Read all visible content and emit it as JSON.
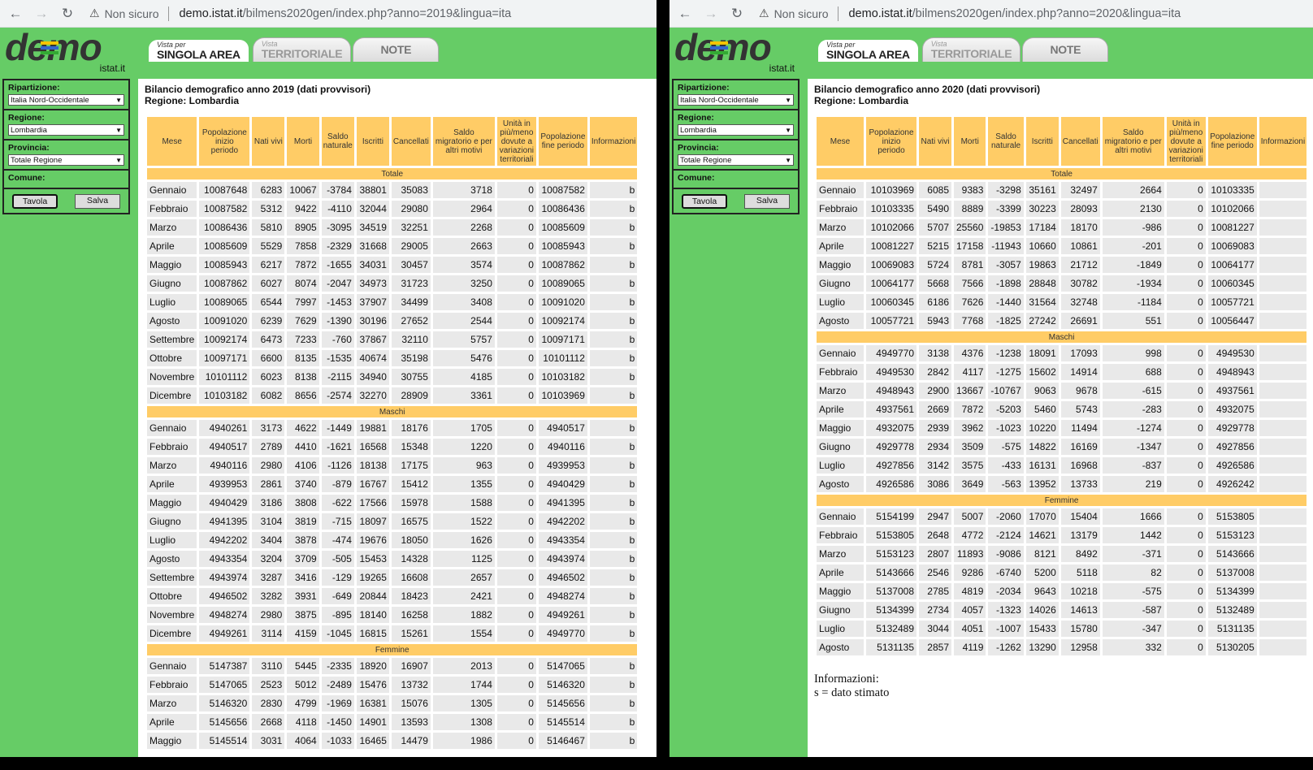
{
  "windows": [
    {
      "url_host": "demo.istat.it",
      "url_path": "/bilmens2020gen/index.php?anno=2019&lingua=ita",
      "security": "Non sicuro",
      "title_line1": "Bilancio demografico anno 2019 (dati provvisori)",
      "title_line2": "Regione: Lombardia",
      "sections": [
        {
          "label": "Totale",
          "rows": [
            [
              "Gennaio",
              "10087648",
              "6283",
              "10067",
              "-3784",
              "38801",
              "35083",
              "3718",
              "0",
              "10087582",
              "b"
            ],
            [
              "Febbraio",
              "10087582",
              "5312",
              "9422",
              "-4110",
              "32044",
              "29080",
              "2964",
              "0",
              "10086436",
              "b"
            ],
            [
              "Marzo",
              "10086436",
              "5810",
              "8905",
              "-3095",
              "34519",
              "32251",
              "2268",
              "0",
              "10085609",
              "b"
            ],
            [
              "Aprile",
              "10085609",
              "5529",
              "7858",
              "-2329",
              "31668",
              "29005",
              "2663",
              "0",
              "10085943",
              "b"
            ],
            [
              "Maggio",
              "10085943",
              "6217",
              "7872",
              "-1655",
              "34031",
              "30457",
              "3574",
              "0",
              "10087862",
              "b"
            ],
            [
              "Giugno",
              "10087862",
              "6027",
              "8074",
              "-2047",
              "34973",
              "31723",
              "3250",
              "0",
              "10089065",
              "b"
            ],
            [
              "Luglio",
              "10089065",
              "6544",
              "7997",
              "-1453",
              "37907",
              "34499",
              "3408",
              "0",
              "10091020",
              "b"
            ],
            [
              "Agosto",
              "10091020",
              "6239",
              "7629",
              "-1390",
              "30196",
              "27652",
              "2544",
              "0",
              "10092174",
              "b"
            ],
            [
              "Settembre",
              "10092174",
              "6473",
              "7233",
              "-760",
              "37867",
              "32110",
              "5757",
              "0",
              "10097171",
              "b"
            ],
            [
              "Ottobre",
              "10097171",
              "6600",
              "8135",
              "-1535",
              "40674",
              "35198",
              "5476",
              "0",
              "10101112",
              "b"
            ],
            [
              "Novembre",
              "10101112",
              "6023",
              "8138",
              "-2115",
              "34940",
              "30755",
              "4185",
              "0",
              "10103182",
              "b"
            ],
            [
              "Dicembre",
              "10103182",
              "6082",
              "8656",
              "-2574",
              "32270",
              "28909",
              "3361",
              "0",
              "10103969",
              "b"
            ]
          ]
        },
        {
          "label": "Maschi",
          "rows": [
            [
              "Gennaio",
              "4940261",
              "3173",
              "4622",
              "-1449",
              "19881",
              "18176",
              "1705",
              "0",
              "4940517",
              "b"
            ],
            [
              "Febbraio",
              "4940517",
              "2789",
              "4410",
              "-1621",
              "16568",
              "15348",
              "1220",
              "0",
              "4940116",
              "b"
            ],
            [
              "Marzo",
              "4940116",
              "2980",
              "4106",
              "-1126",
              "18138",
              "17175",
              "963",
              "0",
              "4939953",
              "b"
            ],
            [
              "Aprile",
              "4939953",
              "2861",
              "3740",
              "-879",
              "16767",
              "15412",
              "1355",
              "0",
              "4940429",
              "b"
            ],
            [
              "Maggio",
              "4940429",
              "3186",
              "3808",
              "-622",
              "17566",
              "15978",
              "1588",
              "0",
              "4941395",
              "b"
            ],
            [
              "Giugno",
              "4941395",
              "3104",
              "3819",
              "-715",
              "18097",
              "16575",
              "1522",
              "0",
              "4942202",
              "b"
            ],
            [
              "Luglio",
              "4942202",
              "3404",
              "3878",
              "-474",
              "19676",
              "18050",
              "1626",
              "0",
              "4943354",
              "b"
            ],
            [
              "Agosto",
              "4943354",
              "3204",
              "3709",
              "-505",
              "15453",
              "14328",
              "1125",
              "0",
              "4943974",
              "b"
            ],
            [
              "Settembre",
              "4943974",
              "3287",
              "3416",
              "-129",
              "19265",
              "16608",
              "2657",
              "0",
              "4946502",
              "b"
            ],
            [
              "Ottobre",
              "4946502",
              "3282",
              "3931",
              "-649",
              "20844",
              "18423",
              "2421",
              "0",
              "4948274",
              "b"
            ],
            [
              "Novembre",
              "4948274",
              "2980",
              "3875",
              "-895",
              "18140",
              "16258",
              "1882",
              "0",
              "4949261",
              "b"
            ],
            [
              "Dicembre",
              "4949261",
              "3114",
              "4159",
              "-1045",
              "16815",
              "15261",
              "1554",
              "0",
              "4949770",
              "b"
            ]
          ]
        },
        {
          "label": "Femmine",
          "rows": [
            [
              "Gennaio",
              "5147387",
              "3110",
              "5445",
              "-2335",
              "18920",
              "16907",
              "2013",
              "0",
              "5147065",
              "b"
            ],
            [
              "Febbraio",
              "5147065",
              "2523",
              "5012",
              "-2489",
              "15476",
              "13732",
              "1744",
              "0",
              "5146320",
              "b"
            ],
            [
              "Marzo",
              "5146320",
              "2830",
              "4799",
              "-1969",
              "16381",
              "15076",
              "1305",
              "0",
              "5145656",
              "b"
            ],
            [
              "Aprile",
              "5145656",
              "2668",
              "4118",
              "-1450",
              "14901",
              "13593",
              "1308",
              "0",
              "5145514",
              "b"
            ],
            [
              "Maggio",
              "5145514",
              "3031",
              "4064",
              "-1033",
              "16465",
              "14479",
              "1986",
              "0",
              "5146467",
              "b"
            ]
          ]
        }
      ],
      "info_title": "",
      "info_text": ""
    },
    {
      "url_host": "demo.istat.it",
      "url_path": "/bilmens2020gen/index.php?anno=2020&lingua=ita",
      "security": "Non sicuro",
      "title_line1": "Bilancio demografico anno 2020 (dati provvisori)",
      "title_line2": "Regione: Lombardia",
      "sections": [
        {
          "label": "Totale",
          "rows": [
            [
              "Gennaio",
              "10103969",
              "6085",
              "9383",
              "-3298",
              "35161",
              "32497",
              "2664",
              "0",
              "10103335",
              ""
            ],
            [
              "Febbraio",
              "10103335",
              "5490",
              "8889",
              "-3399",
              "30223",
              "28093",
              "2130",
              "0",
              "10102066",
              ""
            ],
            [
              "Marzo",
              "10102066",
              "5707",
              "25560",
              "-19853",
              "17184",
              "18170",
              "-986",
              "0",
              "10081227",
              ""
            ],
            [
              "Aprile",
              "10081227",
              "5215",
              "17158",
              "-11943",
              "10660",
              "10861",
              "-201",
              "0",
              "10069083",
              ""
            ],
            [
              "Maggio",
              "10069083",
              "5724",
              "8781",
              "-3057",
              "19863",
              "21712",
              "-1849",
              "0",
              "10064177",
              ""
            ],
            [
              "Giugno",
              "10064177",
              "5668",
              "7566",
              "-1898",
              "28848",
              "30782",
              "-1934",
              "0",
              "10060345",
              ""
            ],
            [
              "Luglio",
              "10060345",
              "6186",
              "7626",
              "-1440",
              "31564",
              "32748",
              "-1184",
              "0",
              "10057721",
              ""
            ],
            [
              "Agosto",
              "10057721",
              "5943",
              "7768",
              "-1825",
              "27242",
              "26691",
              "551",
              "0",
              "10056447",
              ""
            ]
          ]
        },
        {
          "label": "Maschi",
          "rows": [
            [
              "Gennaio",
              "4949770",
              "3138",
              "4376",
              "-1238",
              "18091",
              "17093",
              "998",
              "0",
              "4949530",
              ""
            ],
            [
              "Febbraio",
              "4949530",
              "2842",
              "4117",
              "-1275",
              "15602",
              "14914",
              "688",
              "0",
              "4948943",
              ""
            ],
            [
              "Marzo",
              "4948943",
              "2900",
              "13667",
              "-10767",
              "9063",
              "9678",
              "-615",
              "0",
              "4937561",
              ""
            ],
            [
              "Aprile",
              "4937561",
              "2669",
              "7872",
              "-5203",
              "5460",
              "5743",
              "-283",
              "0",
              "4932075",
              ""
            ],
            [
              "Maggio",
              "4932075",
              "2939",
              "3962",
              "-1023",
              "10220",
              "11494",
              "-1274",
              "0",
              "4929778",
              ""
            ],
            [
              "Giugno",
              "4929778",
              "2934",
              "3509",
              "-575",
              "14822",
              "16169",
              "-1347",
              "0",
              "4927856",
              ""
            ],
            [
              "Luglio",
              "4927856",
              "3142",
              "3575",
              "-433",
              "16131",
              "16968",
              "-837",
              "0",
              "4926586",
              ""
            ],
            [
              "Agosto",
              "4926586",
              "3086",
              "3649",
              "-563",
              "13952",
              "13733",
              "219",
              "0",
              "4926242",
              ""
            ]
          ]
        },
        {
          "label": "Femmine",
          "rows": [
            [
              "Gennaio",
              "5154199",
              "2947",
              "5007",
              "-2060",
              "17070",
              "15404",
              "1666",
              "0",
              "5153805",
              ""
            ],
            [
              "Febbraio",
              "5153805",
              "2648",
              "4772",
              "-2124",
              "14621",
              "13179",
              "1442",
              "0",
              "5153123",
              ""
            ],
            [
              "Marzo",
              "5153123",
              "2807",
              "11893",
              "-9086",
              "8121",
              "8492",
              "-371",
              "0",
              "5143666",
              ""
            ],
            [
              "Aprile",
              "5143666",
              "2546",
              "9286",
              "-6740",
              "5200",
              "5118",
              "82",
              "0",
              "5137008",
              ""
            ],
            [
              "Maggio",
              "5137008",
              "2785",
              "4819",
              "-2034",
              "9643",
              "10218",
              "-575",
              "0",
              "5134399",
              ""
            ],
            [
              "Giugno",
              "5134399",
              "2734",
              "4057",
              "-1323",
              "14026",
              "14613",
              "-587",
              "0",
              "5132489",
              ""
            ],
            [
              "Luglio",
              "5132489",
              "3044",
              "4051",
              "-1007",
              "15433",
              "15780",
              "-347",
              "0",
              "5131135",
              ""
            ],
            [
              "Agosto",
              "5131135",
              "2857",
              "4119",
              "-1262",
              "13290",
              "12958",
              "332",
              "0",
              "5130205",
              ""
            ]
          ]
        }
      ],
      "info_title": "Informazioni:",
      "info_text": "s = dato stimato"
    }
  ],
  "logo": {
    "word": "demo",
    "sub": "istat.it",
    "colors": [
      "#f5c400",
      "#3366cc",
      "#33aa33"
    ]
  },
  "tabs": [
    {
      "small": "Vista per",
      "big": "SINGOLA AREA",
      "state": "active"
    },
    {
      "small": "Vista",
      "big": "TERRITORIALE",
      "state": "inactive"
    },
    {
      "small": "",
      "big": "NOTE",
      "state": "note"
    }
  ],
  "sidebar": {
    "ripartizione_label": "Ripartizione:",
    "ripartizione_value": "Italia Nord-Occidentale",
    "regione_label": "Regione:",
    "regione_value": "Lombardia",
    "provincia_label": "Provincia:",
    "provincia_value": "Totale Regione",
    "comune_label": "Comune:",
    "tavola_label": "Tavola",
    "salva_label": "Salva"
  },
  "columns": [
    "Mese",
    "Popolazione inizio periodo",
    "Nati vivi",
    "Morti",
    "Saldo naturale",
    "Iscritti",
    "Cancellati",
    "Saldo migratorio e per altri motivi",
    "Unità in più/meno dovute a variazioni territoriali",
    "Popolazione fine periodo",
    "Informazioni"
  ],
  "colors": {
    "green": "#66cc66",
    "header_orange": "#ffcc66",
    "cell_grey": "#e9e9e9"
  }
}
